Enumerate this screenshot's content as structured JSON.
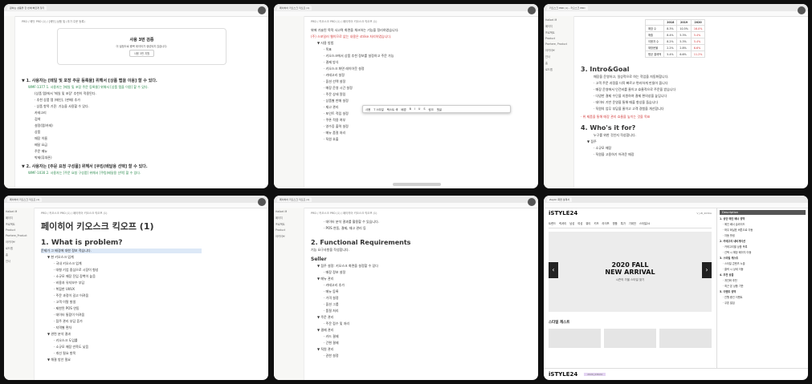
{
  "w1": {
    "tab": "원하는 상품을 한 번에 빠르게 찾기",
    "breadcrumb": "PRD / 에딧 PRD (1) / [에딧] 상품 및 (추가 주문 등록)",
    "card_title": "사용 3번 검증",
    "card_sub": "이 설정으로 중복 데이터가 생성되지 않습니다.",
    "card_btn": "사용 3번 지원",
    "item1": "▼ 1. 사용자는 [메일 및 포장 주문 등록물] 위해서 [상품 탭을 이용] 할 수 있다.",
    "item1_sub": "WMF-1377 1. 사용자는 [메일 및 포장 주문 등록물] 위해서 [상품 탭을 이용] 할 수 있다.",
    "list": [
      "(상품 탭)에서 '메일 및 포장' 추천이 적용된다.",
      "· 추천 상품 탭 (메인), (판매) 추가",
      "· 상품 항목 기준: 기능을 사용할 수 있다.",
      "카테고리",
      "검색",
      "설정(탭/카테)",
      "상품",
      "매장 이름",
      "배달 요금",
      "주문 메뉴",
      "박제(휴대폰)"
    ],
    "item2": "▼ 2. 사용자는 [주문 요청 구성품] 위해서 [쿠킹(배달용 선택] 할 수 있다.",
    "item2_sub": "WMF-1030 2. 사용자는 [주문 요청 구성품] 위해서 [쿠킹(배달용 선택] 할 수 있다."
  },
  "w2": {
    "tab": "페이히어 키오스크 킥오프 (1)",
    "breadcrumb": "PRD / 키오스크 PRD (1) / 페이히어 키오스크 킥오프 (1)",
    "intro": "위에 기술된 목적 사고력 화면을 체크하는 기능을 정리하였습니다.",
    "note": "(주) 스포일러 웹이므로 없는 내용은 strike 처리하였습니다.",
    "lines": [
      "▼ 사용 방법",
      "· 목표",
      "· 키오스크에서 상품 추천 정보를 설정하고 주문 가능",
      "· 결제 방식",
      "· 키오스크 화면 레이아웃 설정",
      "· 카테고리 설정",
      "· 옵션 선택 설정",
      "· 매장 운영 시간 설정",
      "· 주문 상태 알림",
      "· 상품별 판매 설정",
      "· 재고 관리",
      "· 포인트 적립 설정",
      "· 쿠폰 적용 여부",
      "· 영수증 출력 설정",
      "· 메뉴 품절 처리",
      "· 직원 호출"
    ],
    "toolbar": [
      "사용",
      "T 스타일",
      "텍스트 색",
      "배경",
      "B",
      "I",
      "U",
      "S",
      "링크",
      "댓글"
    ]
  },
  "w3": {
    "tab": "키오스크 PRD (1) - 키오스크 PRD",
    "table_head": [
      "",
      "2018",
      "2019",
      "2020"
    ],
    "table_rows": [
      [
        "매장 수",
        "8.3%",
        "10.5%",
        "16.0%"
      ],
      [
        "매출",
        "8.4%",
        "5.3%",
        "5.4%"
      ],
      [
        "이용자 수",
        "8.2%",
        "5.3%",
        "5.4%"
      ],
      [
        "재방문율",
        "2.2%",
        "2.8%",
        "6.6%"
      ],
      [
        "평균 결제액",
        "5.4%",
        "6.6%",
        "11.2%"
      ]
    ],
    "h_intro": "3. Intro&Goal",
    "intro_lines": [
      "매장을 운영하고, 일상적으로 하는 작업을 자동화합니다.",
      "· 고객 주문 과정을 더욱 빠르고 편리하게 만들어 줍니다",
      "· 매장 운영에서 인건비를 줄이고 효율적으로 주문을 받습니다",
      "· 다양한 결제 수단을 지원하여 결제 편의성을 높입니다",
      "· 데이터 기반 운영을 통해 매출 향상을 돕습니다",
      "· 직원의 업무 부담을 줄이고 고객 경험을 개선합니다"
    ],
    "goal": "· 위 제품을 통해 매장 관리 효율을 높이는 것을 목표",
    "h_who": "4. Who's it for?",
    "who_lines": [
      "누구를 위한 것인지 작성합니다.",
      "▼ 점주",
      "· 소규모 매장",
      "· 직원을 고용하기 어려운 매장"
    ],
    "sidebar": [
      "Halbet M",
      "페이지",
      "프로젝트",
      "Product",
      "Paehere, Product",
      "아카이브",
      "인사",
      "홈",
      "로드맵"
    ]
  },
  "w4": {
    "tab": "페이히어 키오스크 킥오프 (1)",
    "breadcrumb": "PRD / 키오스크 PRD (1) / 페이히어 키오스크 킥오프 (1)",
    "title": "페이히어 키오스크 킥오프 (1)",
    "h2": "1. What is problem?",
    "hl": "문제가 그 배경에 대한 정보 적습니다.",
    "lines": [
      "▼ 현 키오스크 업계",
      "· 국내 키오스크 업계",
      "· 대형 기업 중심으로 시장이 형성",
      "· 소규모 매장 진입 장벽이 높음",
      "· 비용과 유지보수 부담",
      "· 복잡한 UI/UX",
      "· 주문 과정이 길고 어려움",
      "· 고객 이탈 발생",
      "· 제한된 POS 연동",
      "· 데이터 통합이 어려움",
      "· 점주 관리 부담 증가",
      "· 지역별 편차",
      "▼ 관련 분석 결과",
      "· 키오스크 도입률",
      "· 소규모 매장 만족도 낮음",
      "· 개선 필요 항목",
      "▼ 해결 방안 필요"
    ],
    "sidebar": [
      "Halbet M",
      "페이지",
      "프로젝트",
      "Product",
      "Paehere_Product",
      "아카이브",
      "로드맵",
      "홈",
      "인사"
    ]
  },
  "w5": {
    "tab": "페이히어 키오스크 킥오프 (1)",
    "breadcrumb": "PRD / 키오스크 PRD (1) / 페이히어 키오스크 킥오프 (1)",
    "top_lines": [
      "· 데이터 분석 결과를 활용할 수 있습니다.",
      "· POS 연동, 결제, 재고 관리 등"
    ],
    "h2": "2. Functional Requirements",
    "sub": "기능 요구사항을 작성합니다.",
    "h3": "Seller",
    "lines": [
      "▼ 점주 설정: 키오스크 화면을 설정할 수 있다",
      "· 매장 정보 설정",
      "▼ 메뉴 관리",
      "· 카테고리 추가",
      "· 메뉴 등록",
      "· 가격 설정",
      "· 옵션 그룹",
      "· 품절 처리",
      "▼ 주문 관리",
      "· 주문 접수 및 처리",
      "▼ 결제 관리",
      "· 카드 결제",
      "· 간편 결제",
      "▼ 직원 관리",
      "· 권한 설정"
    ],
    "sidebar": [
      "Halbet M",
      "페이지",
      "프로젝트",
      "Product",
      "아카이브"
    ]
  },
  "w6": {
    "tab": "Zeplin 화면 설계서",
    "brand": "iSTYLE24",
    "banner_title": "2020 FALL",
    "banner_title2": "NEW ARRIVAL",
    "banner_sub": "시즌의 가을 스타일 찾기",
    "section": "스타일 캐스트",
    "nav": [
      "트렌드",
      "럭셔리",
      "남성",
      "여성",
      "뷰티",
      "키즈",
      "라이프",
      "명품",
      "특가",
      "기획전",
      "스타일24"
    ],
    "panel_title": "Description",
    "panel_lines": [
      "1. 상단 메인 배너 영역",
      "· 메인 배너 슬라이드",
      "· 좌우 화살표 버튼으로 이동",
      "· 자동 롤링",
      "2. 카테고리 네비게이션",
      "· 카테고리별 상품 목록",
      "· 선택 시 해당 페이지 이동",
      "3. 스타일 캐스트",
      "· 스타일 콘텐츠 노출",
      "· 클릭 시 상세 이동",
      "4. 추천 상품",
      "· 개인화 추천",
      "· 최근 본 상품 기반",
      "5. 이벤트 영역",
      "· 진행 중인 이벤트",
      "· 쿠폰 발급"
    ],
    "header_code": "V_LB_2030A",
    "footer_code": "2020_03024"
  }
}
